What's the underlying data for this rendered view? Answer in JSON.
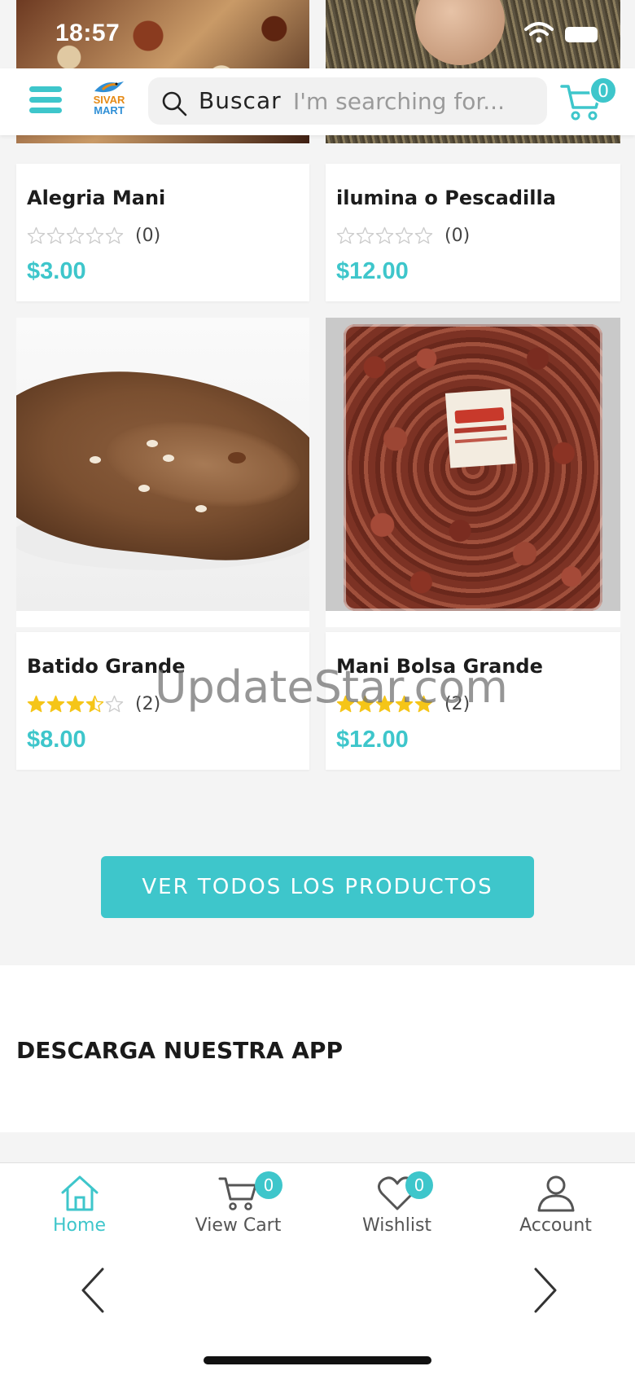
{
  "status_bar": {
    "time": "18:57"
  },
  "header": {
    "logo_line1": "SIVAR",
    "logo_line2": "MART",
    "search_label": "Buscar",
    "search_placeholder": "I'm searching for...",
    "cart_count": "0"
  },
  "products": [
    {
      "name": "Alegria Mani",
      "rating_stars": 0,
      "rating_count": "(0)",
      "price": "$3.00"
    },
    {
      "name": "ilumina o Pescadilla",
      "rating_stars": 0,
      "rating_count": "(0)",
      "price": "$12.00"
    },
    {
      "name": "Batido Grande",
      "rating_stars": 3.5,
      "rating_count": "(2)",
      "price": "$8.00"
    },
    {
      "name": "Mani Bolsa Grande",
      "rating_stars": 5,
      "rating_count": "(2)",
      "price": "$12.00"
    }
  ],
  "watermark": "UpdateStar.com",
  "view_all_label": "VER TODOS LOS PRODUCTOS",
  "download_section": {
    "title": "DESCARGA NUESTRA APP"
  },
  "tab_bar": {
    "tabs": [
      {
        "label": "Home",
        "icon": "home-icon",
        "active": true
      },
      {
        "label": "View Cart",
        "icon": "cart-icon",
        "badge": "0"
      },
      {
        "label": "Wishlist",
        "icon": "heart-icon",
        "badge": "0"
      },
      {
        "label": "Account",
        "icon": "user-icon"
      }
    ]
  },
  "colors": {
    "accent": "#3ec6cb",
    "star": "#f5c518",
    "star_empty": "#cccccc"
  }
}
